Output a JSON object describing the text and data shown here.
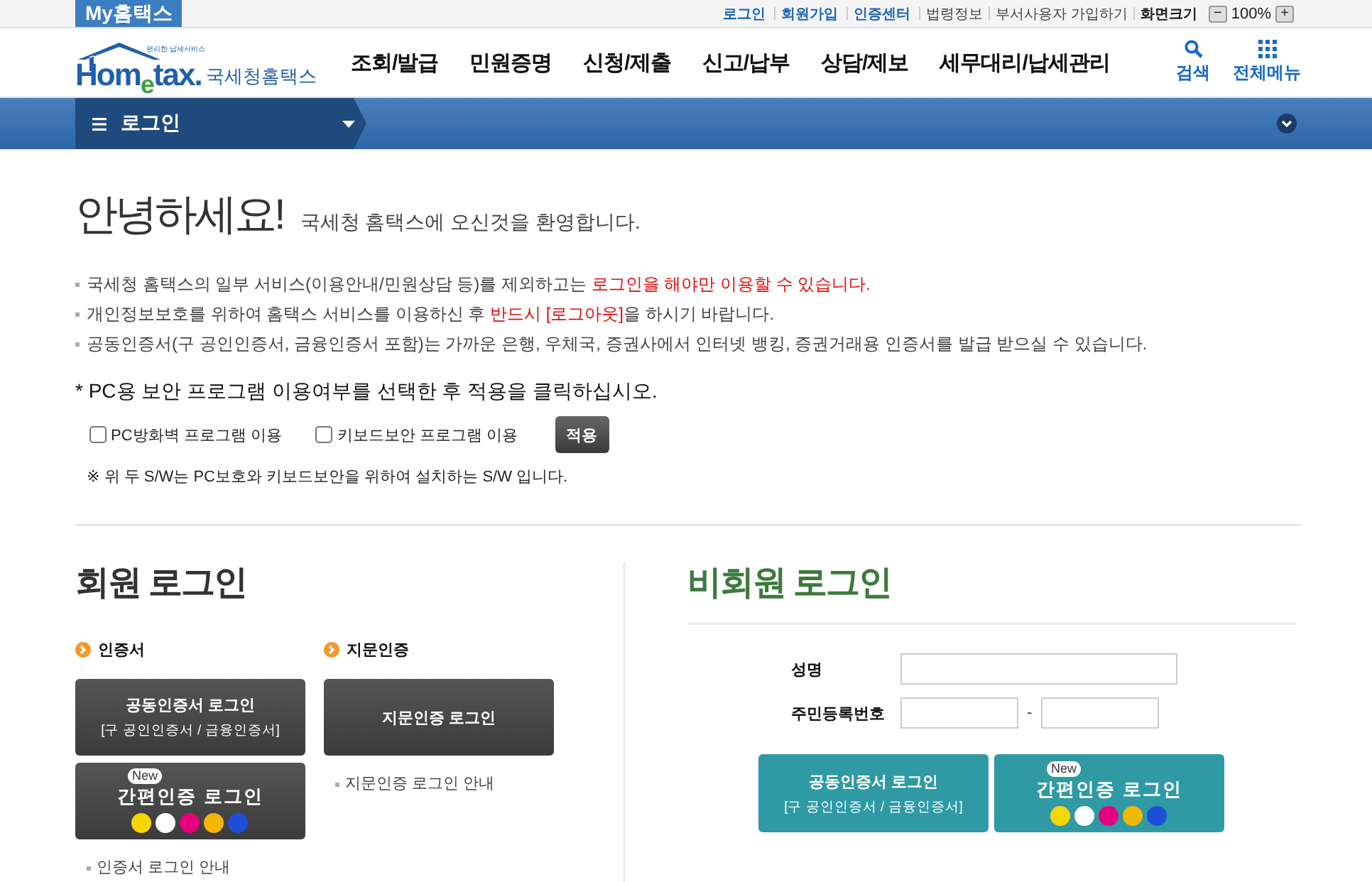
{
  "top_bar": {
    "my_tab": "My홈택스",
    "links": [
      {
        "label": "로그인",
        "highlight": true
      },
      {
        "label": "회원가입",
        "highlight": true
      },
      {
        "label": "인증센터",
        "highlight": true
      },
      {
        "label": "법령정보",
        "highlight": false
      },
      {
        "label": "부서사용자 가입하기",
        "highlight": false
      }
    ],
    "zoom": {
      "label": "화면크기",
      "minus": "−",
      "value": "100%",
      "plus": "+"
    }
  },
  "header": {
    "logo": {
      "tagline": "편리한 납세서비스",
      "brand": "Hom$_{e}$tax.",
      "name": "국세청홈택스"
    },
    "nav": [
      "조회/발급",
      "민원증명",
      "신청/제출",
      "신고/납부",
      "상담/제보",
      "세무대리/납세관리"
    ],
    "tools": [
      {
        "kind": "search",
        "label": "검색"
      },
      {
        "kind": "menu",
        "label": "전체메뉴"
      }
    ]
  },
  "breadcrumb": {
    "label": "로그인"
  },
  "greeting": {
    "title": "안녕하세요!",
    "subtitle": "국세청 홈택스에 오신것을 환영합니다."
  },
  "notices": [
    [
      {
        "text": "국세청 홈택스의 일부 서비스(이용안내/민원상담 등)를 제외하고는 ",
        "emphasis": false
      },
      {
        "text": "로그인을 해야만 이용할 수 있습니다.",
        "emphasis": true
      }
    ],
    [
      {
        "text": "개인정보보호를 위하여 홈택스 서비스를 이용하신 후 ",
        "emphasis": false
      },
      {
        "text": "반드시 [로그아웃]",
        "emphasis": true
      },
      {
        "text": "을 하시기 바랍니다.",
        "emphasis": false
      }
    ],
    [
      {
        "text": "공동인증서(구 공인인증서, 금융인증서 포함)는 가까운 은행, 우체국, 증권사에서 인터넷 뱅킹, 증권거래용 인증서를 발급 받으실 수 있습니다.",
        "emphasis": false
      }
    ]
  ],
  "security": {
    "title": "* PC용 보안 프로그램 이용여부를 선택한 후 적용을 클릭하십시오.",
    "options": [
      {
        "label": "PC방화벽 프로그램 이용",
        "checked": false
      },
      {
        "label": "키보드보안 프로그램 이용",
        "checked": false
      }
    ],
    "apply": "적용",
    "note": "※ 위 두 S/W는 PC보호와 키보드보안을 위하여 설치하는 S/W 입니다."
  },
  "member_login": {
    "title": "회원 로그인",
    "sections": [
      {
        "heading": "인증서",
        "buttons": [
          {
            "kind": "certificate",
            "title": "공동인증서 로그인",
            "subtitle": "[구 공인인증서 / 금융인증서]"
          },
          {
            "kind": "simple",
            "badge": "New",
            "title": "간편인증 로그인"
          }
        ],
        "guide": "인증서 로그인 안내"
      },
      {
        "heading": "지문인증",
        "buttons": [
          {
            "kind": "certificate",
            "title": "지문인증 로그인"
          }
        ],
        "guide": "지문인증 로그인 안내"
      }
    ]
  },
  "guest_login": {
    "title": "비회원 로그인",
    "fields": [
      {
        "kind": "single",
        "label": "성명"
      },
      {
        "kind": "split",
        "label": "주민등록번호",
        "separator": "-"
      }
    ],
    "buttons": [
      {
        "kind": "certificate",
        "title": "공동인증서 로그인",
        "subtitle": "[구 공인인증서 / 금융인증서]"
      },
      {
        "kind": "simple",
        "badge": "New",
        "title": "간편인증 로그인"
      }
    ]
  }
}
